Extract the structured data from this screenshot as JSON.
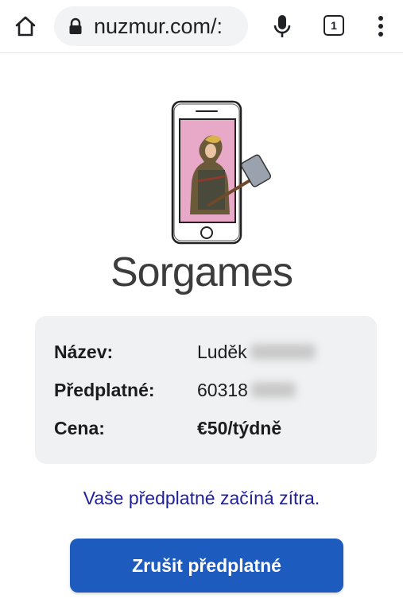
{
  "browser": {
    "url": "nuzmur.com/:",
    "tab_count": "1",
    "icons": {
      "home": "home-icon",
      "lock": "lock-icon",
      "mic": "microphone-icon",
      "tabs": "tab-switcher-icon",
      "menu": "overflow-menu-icon"
    }
  },
  "brand": {
    "name": "Sorgames",
    "logo": "phone-with-game-character-logo"
  },
  "details": {
    "name_label": "Název:",
    "name_value": "Luděk",
    "subscription_label": "Předplatné:",
    "subscription_value": "60318",
    "price_label": "Cena:",
    "price_value": "€50/týdně"
  },
  "notice": "Vaše předplatné začíná zítra.",
  "cancel_button": "Zrušit předplatné",
  "colors": {
    "price": "#1e8e1e",
    "notice": "#1f1f9e",
    "button": "#1d5bbf",
    "card": "#f0f1f3"
  }
}
